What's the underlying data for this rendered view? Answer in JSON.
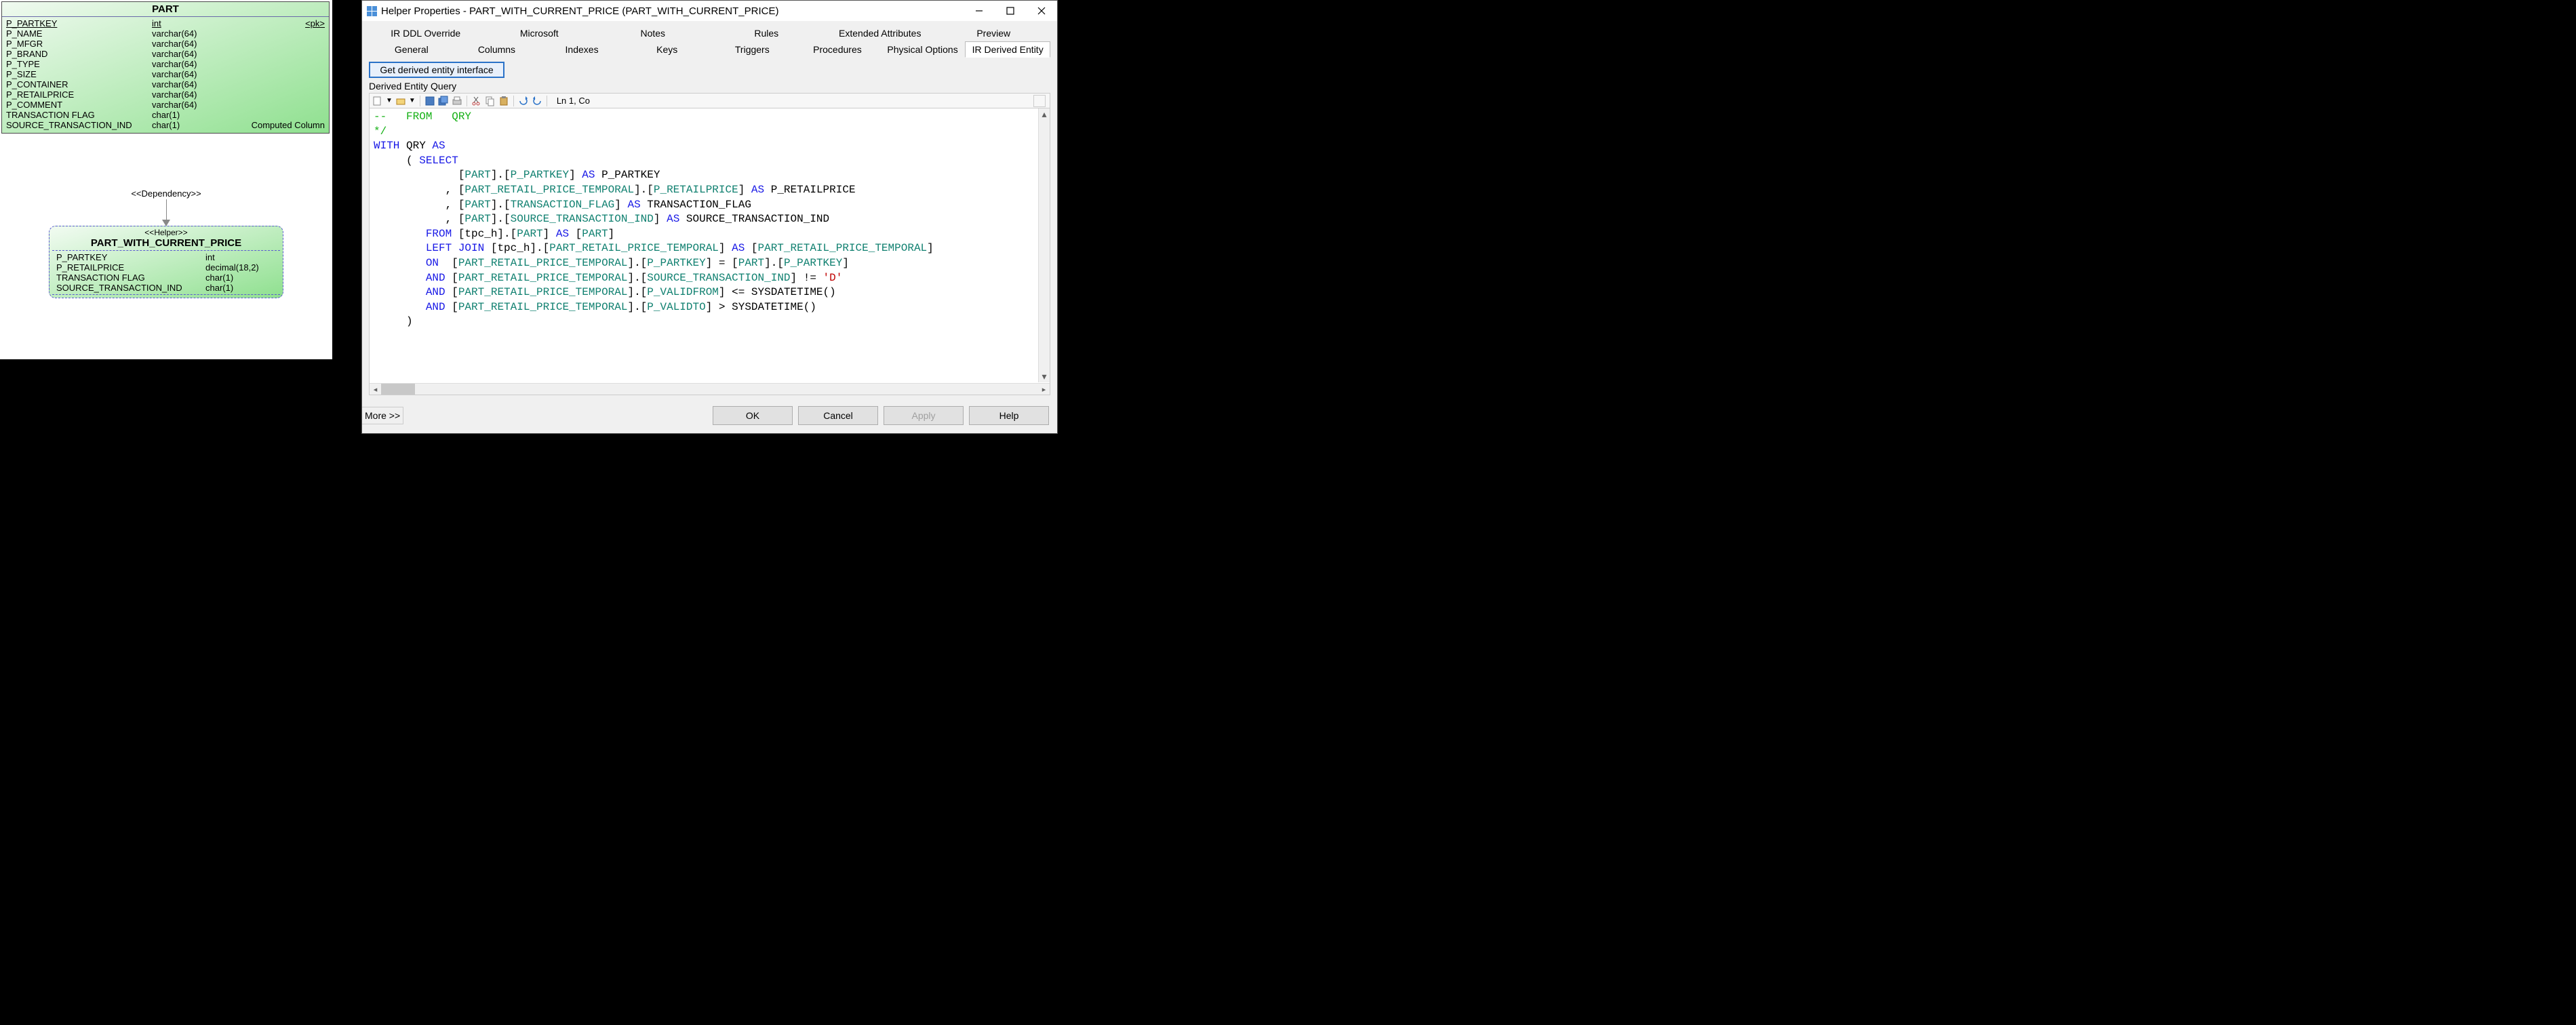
{
  "diagram": {
    "part": {
      "title": "PART",
      "rows": [
        {
          "name": "P_PARTKEY",
          "type": "int",
          "extra": "<pk>",
          "u": true
        },
        {
          "name": "P_NAME",
          "type": "varchar(64)",
          "extra": ""
        },
        {
          "name": "P_MFGR",
          "type": "varchar(64)",
          "extra": ""
        },
        {
          "name": "P_BRAND",
          "type": "varchar(64)",
          "extra": ""
        },
        {
          "name": "P_TYPE",
          "type": "varchar(64)",
          "extra": ""
        },
        {
          "name": "P_SIZE",
          "type": "varchar(64)",
          "extra": ""
        },
        {
          "name": "P_CONTAINER",
          "type": "varchar(64)",
          "extra": ""
        },
        {
          "name": "P_RETAILPRICE",
          "type": "varchar(64)",
          "extra": ""
        },
        {
          "name": "P_COMMENT",
          "type": "varchar(64)",
          "extra": ""
        },
        {
          "name": "TRANSACTION FLAG",
          "type": "char(1)",
          "extra": ""
        },
        {
          "name": "SOURCE_TRANSACTION_IND",
          "type": "char(1)",
          "extra": "Computed Column"
        }
      ]
    },
    "dependency_label": "<<Dependency>>",
    "helper": {
      "stereo": "<<Helper>>",
      "title": "PART_WITH_CURRENT_PRICE",
      "rows": [
        {
          "name": "P_PARTKEY",
          "type": "int"
        },
        {
          "name": "P_RETAILPRICE",
          "type": "decimal(18,2)"
        },
        {
          "name": "TRANSACTION FLAG",
          "type": "char(1)"
        },
        {
          "name": "SOURCE_TRANSACTION_IND",
          "type": "char(1)"
        }
      ]
    }
  },
  "window": {
    "title": "Helper Properties - PART_WITH_CURRENT_PRICE (PART_WITH_CURRENT_PRICE)",
    "tabs_row1": [
      "IR DDL Override",
      "Microsoft",
      "Notes",
      "Rules",
      "Extended Attributes",
      "Preview"
    ],
    "tabs_row2": [
      "General",
      "Columns",
      "Indexes",
      "Keys",
      "Triggers",
      "Procedures",
      "Physical Options",
      "IR Derived Entity"
    ],
    "active_tab": "IR Derived Entity",
    "get_button": "Get derived entity interface",
    "section_label": "Derived Entity Query",
    "cursor_pos": "Ln 1, Co",
    "code": {
      "l1a": "--   ",
      "l1b": "FROM   QRY",
      "l2": "*/",
      "l3a": "WITH",
      "l3b": " QRY ",
      "l3c": "AS",
      "l4a": "     ( ",
      "l4b": "SELECT",
      "l5a": "             ",
      "l5b": "[",
      "l5c": "PART",
      "l5d": "].[",
      "l5e": "P_PARTKEY",
      "l5f": "]",
      " l5g": " ",
      "l5h": "AS",
      "l5i": " P_PARTKEY",
      "l6a": "           , ",
      "l6b": "[",
      "l6c": "PART_RETAIL_PRICE_TEMPORAL",
      "l6d": "].[",
      "l6e": "P_RETAILPRICE",
      "l6f": "]",
      "l6h": " AS",
      "l6i": " P_RETAILPRICE",
      "l7a": "           , ",
      "l7b": "[",
      "l7c": "PART",
      "l7d": "].[",
      "l7e": "TRANSACTION_FLAG",
      "l7f": "]",
      "l7h": " AS",
      "l7i": " TRANSACTION_FLAG",
      "l8a": "           , ",
      "l8b": "[",
      "l8c": "PART",
      "l8d": "].[",
      "l8e": "SOURCE_TRANSACTION_IND",
      "l8f": "]",
      "l8h": " AS",
      "l8i": " SOURCE_TRANSACTION_IND",
      "l9a": "        ",
      "l9b": "FROM",
      "l9c": " [tpc_h].[",
      "l9d": "PART",
      "l9e": "] ",
      "l9f": "AS",
      "l9g": " [",
      "l9h": "PART",
      "l9i": "]",
      "l10a": "        ",
      "l10b": "LEFT",
      "l10c": " ",
      "l10d": "JOIN",
      "l10e": " [tpc_h].[",
      "l10f": "PART_RETAIL_PRICE_TEMPORAL",
      "l10g": "] ",
      "l10h": "AS",
      "l10i": " [",
      "l10j": "PART_RETAIL_PRICE_TEMPORAL",
      "l10k": "]",
      "l11a": "        ",
      "l11b": "ON",
      "l11c": "  [",
      "l11d": "PART_RETAIL_PRICE_TEMPORAL",
      "l11e": "].[",
      "l11f": "P_PARTKEY",
      "l11g": "] = [",
      "l11h": "PART",
      "l11i": "].[",
      "l11j": "P_PARTKEY",
      "l11k": "]",
      "l12a": "        ",
      "l12b": "AND",
      "l12c": " [",
      "l12d": "PART_RETAIL_PRICE_TEMPORAL",
      "l12e": "].[",
      "l12f": "SOURCE_TRANSACTION_IND",
      "l12g": "] != ",
      "l12h": "'D'",
      "l13a": "        ",
      "l13b": "AND",
      "l13c": " [",
      "l13d": "PART_RETAIL_PRICE_TEMPORAL",
      "l13e": "].[",
      "l13f": "P_VALIDFROM",
      "l13g": "] <= SYSDATETIME()",
      "l14a": "        ",
      "l14b": "AND",
      "l14c": " [",
      "l14d": "PART_RETAIL_PRICE_TEMPORAL",
      "l14e": "].[",
      "l14f": "P_VALIDTO",
      "l14g": "] > SYSDATETIME()",
      "l15": "     )"
    },
    "buttons": {
      "more": "More >>",
      "ok": "OK",
      "cancel": "Cancel",
      "apply": "Apply",
      "help": "Help"
    }
  }
}
